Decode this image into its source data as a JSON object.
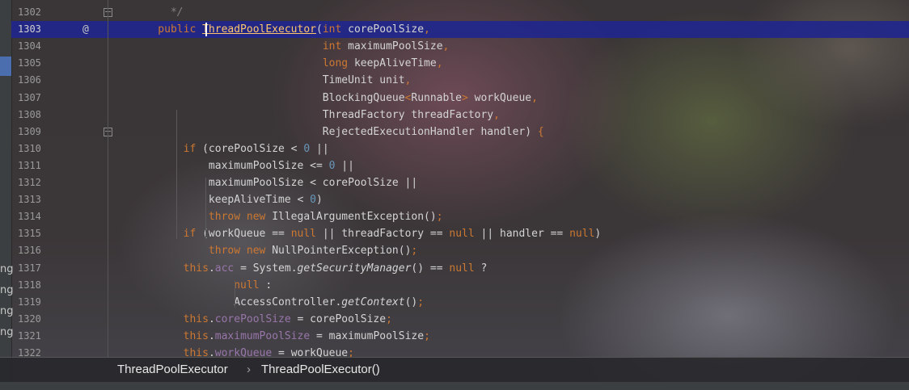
{
  "editor": {
    "lines": [
      {
        "no": "1302",
        "parts": [
          {
            "t": "      */",
            "c": "comment"
          }
        ]
      },
      {
        "no": "1303",
        "active": true,
        "parts": [
          {
            "t": "    public ",
            "c": "kw"
          },
          {
            "t": "ThreadPoolExecutor",
            "c": "method"
          },
          {
            "t": "(",
            "c": ""
          },
          {
            "t": "int ",
            "c": "kw"
          },
          {
            "t": "corePoolSize",
            "c": ""
          },
          {
            "t": ",",
            "c": "kw"
          }
        ]
      },
      {
        "no": "1304",
        "parts": [
          {
            "t": "                              ",
            "c": ""
          },
          {
            "t": "int ",
            "c": "kw"
          },
          {
            "t": "maximumPoolSize",
            "c": ""
          },
          {
            "t": ",",
            "c": "kw"
          }
        ]
      },
      {
        "no": "1305",
        "parts": [
          {
            "t": "                              ",
            "c": ""
          },
          {
            "t": "long ",
            "c": "kw"
          },
          {
            "t": "keepAliveTime",
            "c": ""
          },
          {
            "t": ",",
            "c": "kw"
          }
        ]
      },
      {
        "no": "1306",
        "parts": [
          {
            "t": "                              TimeUnit unit",
            "c": ""
          },
          {
            "t": ",",
            "c": "kw"
          }
        ]
      },
      {
        "no": "1307",
        "parts": [
          {
            "t": "                              BlockingQueue",
            "c": ""
          },
          {
            "t": "<",
            "c": "kw"
          },
          {
            "t": "Runnable",
            "c": ""
          },
          {
            "t": ">",
            "c": "kw"
          },
          {
            "t": " workQueue",
            "c": ""
          },
          {
            "t": ",",
            "c": "kw"
          }
        ]
      },
      {
        "no": "1308",
        "parts": [
          {
            "t": "                              ThreadFactory threadFactory",
            "c": ""
          },
          {
            "t": ",",
            "c": "kw"
          }
        ]
      },
      {
        "no": "1309",
        "parts": [
          {
            "t": "                              RejectedExecutionHandler handler) ",
            "c": ""
          },
          {
            "t": "{",
            "c": "kw"
          }
        ]
      },
      {
        "no": "1310",
        "parts": [
          {
            "t": "        ",
            "c": ""
          },
          {
            "t": "if ",
            "c": "kw"
          },
          {
            "t": "(corePoolSize < ",
            "c": ""
          },
          {
            "t": "0",
            "c": "num-lit"
          },
          {
            "t": " ||",
            "c": ""
          }
        ]
      },
      {
        "no": "1311",
        "parts": [
          {
            "t": "            maximumPoolSize <= ",
            "c": ""
          },
          {
            "t": "0",
            "c": "num-lit"
          },
          {
            "t": " ||",
            "c": ""
          }
        ]
      },
      {
        "no": "1312",
        "parts": [
          {
            "t": "            maximumPoolSize < corePoolSize ||",
            "c": ""
          }
        ]
      },
      {
        "no": "1313",
        "parts": [
          {
            "t": "            keepAliveTime < ",
            "c": ""
          },
          {
            "t": "0",
            "c": "num-lit"
          },
          {
            "t": ")",
            "c": ""
          }
        ]
      },
      {
        "no": "1314",
        "parts": [
          {
            "t": "            ",
            "c": ""
          },
          {
            "t": "throw new ",
            "c": "kw"
          },
          {
            "t": "IllegalArgumentException",
            "c": ""
          },
          {
            "t": "()",
            "c": ""
          },
          {
            "t": ";",
            "c": "kw"
          }
        ]
      },
      {
        "no": "1315",
        "parts": [
          {
            "t": "        ",
            "c": ""
          },
          {
            "t": "if ",
            "c": "kw"
          },
          {
            "t": "(workQueue == ",
            "c": ""
          },
          {
            "t": "null",
            "c": "kw"
          },
          {
            "t": " || threadFactory == ",
            "c": ""
          },
          {
            "t": "null",
            "c": "kw"
          },
          {
            "t": " || handler == ",
            "c": ""
          },
          {
            "t": "null",
            "c": "kw"
          },
          {
            "t": ")",
            "c": ""
          }
        ]
      },
      {
        "no": "1316",
        "parts": [
          {
            "t": "            ",
            "c": ""
          },
          {
            "t": "throw new ",
            "c": "kw"
          },
          {
            "t": "NullPointerException",
            "c": ""
          },
          {
            "t": "()",
            "c": ""
          },
          {
            "t": ";",
            "c": "kw"
          }
        ]
      },
      {
        "no": "1317",
        "parts": [
          {
            "t": "        ",
            "c": ""
          },
          {
            "t": "this",
            "c": "kw"
          },
          {
            "t": ".",
            "c": ""
          },
          {
            "t": "acc",
            "c": "field"
          },
          {
            "t": " = System.",
            "c": ""
          },
          {
            "t": "getSecurityManager",
            "c": "italic"
          },
          {
            "t": "() == ",
            "c": ""
          },
          {
            "t": "null",
            "c": "kw"
          },
          {
            "t": " ?",
            "c": ""
          }
        ]
      },
      {
        "no": "1318",
        "parts": [
          {
            "t": "                ",
            "c": ""
          },
          {
            "t": "null",
            "c": "kw"
          },
          {
            "t": " :",
            "c": ""
          }
        ]
      },
      {
        "no": "1319",
        "parts": [
          {
            "t": "                AccessController.",
            "c": ""
          },
          {
            "t": "getContext",
            "c": "italic"
          },
          {
            "t": "()",
            "c": ""
          },
          {
            "t": ";",
            "c": "kw"
          }
        ]
      },
      {
        "no": "1320",
        "parts": [
          {
            "t": "        ",
            "c": ""
          },
          {
            "t": "this",
            "c": "kw"
          },
          {
            "t": ".",
            "c": ""
          },
          {
            "t": "corePoolSize",
            "c": "field"
          },
          {
            "t": " = corePoolSize",
            "c": ""
          },
          {
            "t": ";",
            "c": "kw"
          }
        ]
      },
      {
        "no": "1321",
        "parts": [
          {
            "t": "        ",
            "c": ""
          },
          {
            "t": "this",
            "c": "kw"
          },
          {
            "t": ".",
            "c": ""
          },
          {
            "t": "maximumPoolSize",
            "c": "field"
          },
          {
            "t": " = maximumPoolSize",
            "c": ""
          },
          {
            "t": ";",
            "c": "kw"
          }
        ]
      },
      {
        "no": "1322",
        "parts": [
          {
            "t": "        ",
            "c": ""
          },
          {
            "t": "this",
            "c": "kw"
          },
          {
            "t": ".",
            "c": ""
          },
          {
            "t": "workQueue",
            "c": "field"
          },
          {
            "t": " = workQueue",
            "c": ""
          },
          {
            "t": ";",
            "c": "kw"
          }
        ]
      }
    ],
    "override_marker": "@"
  },
  "breadcrumb": {
    "items": [
      "ThreadPoolExecutor",
      "ThreadPoolExecutor()"
    ],
    "separator": "›"
  },
  "left_panel": {
    "fragments": [
      "ng",
      "ng",
      "ng",
      "ng"
    ]
  },
  "colors": {
    "keyword": "#cc7832",
    "number": "#6897bb",
    "field": "#9876aa",
    "active_line": "#21268c"
  }
}
